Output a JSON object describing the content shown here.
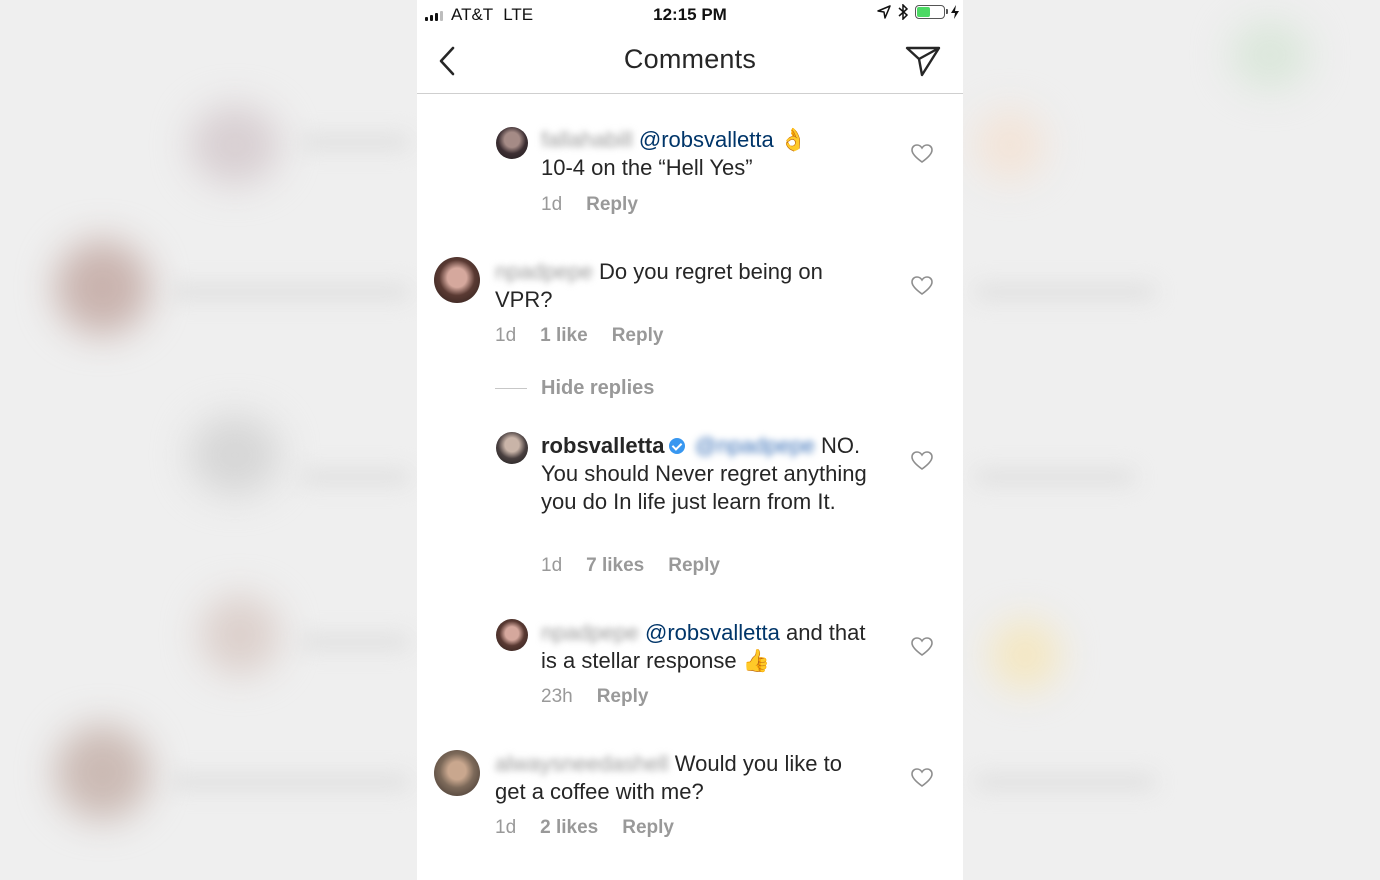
{
  "status_bar": {
    "carrier": "AT&T",
    "network": "LTE",
    "time": "12:15 PM"
  },
  "header": {
    "title": "Comments",
    "back_icon": "chevron-left-icon",
    "send_icon": "paper-plane-icon"
  },
  "comments": [
    {
      "username": "fallahabill",
      "mention": "@robsvalletta",
      "text": "10-4 on the “Hell Yes”",
      "emoji": "👌",
      "time": "1d",
      "likes": "",
      "reply_label": "Reply",
      "is_reply": true
    },
    {
      "username": "npadpepe",
      "mention": "",
      "text": "Do you regret being on VPR?",
      "time": "1d",
      "likes": "1 like",
      "reply_label": "Reply",
      "is_reply": false
    },
    {
      "username": "robsvalletta",
      "verified": true,
      "mention": "@npadpepe",
      "text": "NO. You should Never regret anything you do In life just learn from It.",
      "time": "1d",
      "likes": "7 likes",
      "reply_label": "Reply",
      "is_reply": true
    },
    {
      "username": "npadpepe",
      "mention": "@robsvalletta",
      "text": "and that is a stellar response",
      "emoji": "👍",
      "time": "23h",
      "likes": "",
      "reply_label": "Reply",
      "is_reply": true
    },
    {
      "username": "alwaysneedashell",
      "mention": "",
      "text": "Would you like to get a coffee with me?",
      "time": "1d",
      "likes": "2 likes",
      "reply_label": "Reply",
      "is_reply": false
    }
  ],
  "hide_replies_label": "Hide replies",
  "colors": {
    "mention": "#003569",
    "meta_text": "#999999",
    "verified_badge": "#3897f0",
    "battery": "#4cd964"
  }
}
